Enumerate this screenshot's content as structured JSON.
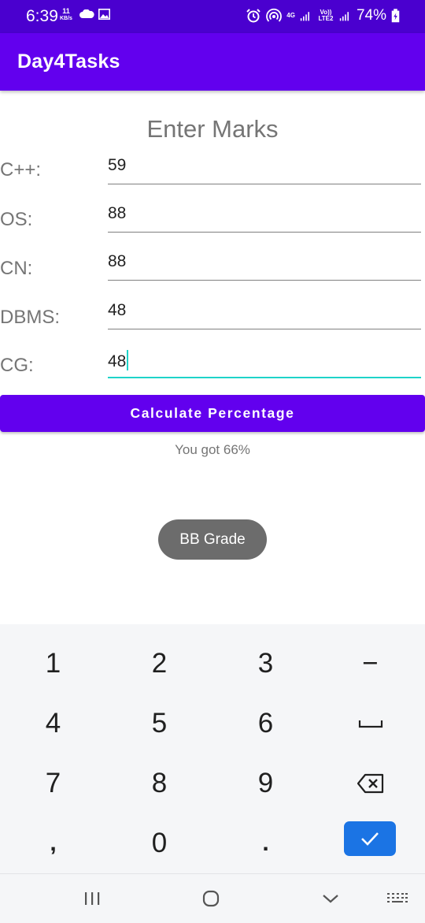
{
  "status_bar": {
    "time": "6:39",
    "data_speed_value": "11",
    "data_speed_unit": "KB/s",
    "net_type": "4G",
    "volte": "Vo)) LTE2",
    "battery": "74%"
  },
  "app_bar": {
    "title": "Day4Tasks"
  },
  "form": {
    "heading": "Enter Marks",
    "fields": [
      {
        "label": "C++:",
        "value": "59"
      },
      {
        "label": "OS:",
        "value": "88"
      },
      {
        "label": "CN:",
        "value": "88"
      },
      {
        "label": "DBMS:",
        "value": "48"
      },
      {
        "label": "CG:",
        "value": "48"
      }
    ],
    "calculate_label": "Calculate Percentage",
    "result_text": "You got 66%",
    "grade_toast": "BB Grade"
  },
  "keyboard": {
    "keys": [
      "1",
      "2",
      "3",
      "−",
      "4",
      "5",
      "6",
      "space",
      "7",
      "8",
      "9",
      "backspace",
      ",",
      "0",
      ".",
      "done"
    ],
    "labels": {
      "k1": "1",
      "k2": "2",
      "k3": "3",
      "minus": "−",
      "k4": "4",
      "k5": "5",
      "k6": "6",
      "k7": "7",
      "k8": "8",
      "k9": "9",
      "comma": ",",
      "k0": "0",
      "period": "."
    }
  },
  "colors": {
    "status_bar": "#4a00cf",
    "app_bar": "#6200ee",
    "accent_cursor": "#1ed3c9",
    "done_key": "#1b74e4",
    "toast": "#6c6c6c"
  }
}
